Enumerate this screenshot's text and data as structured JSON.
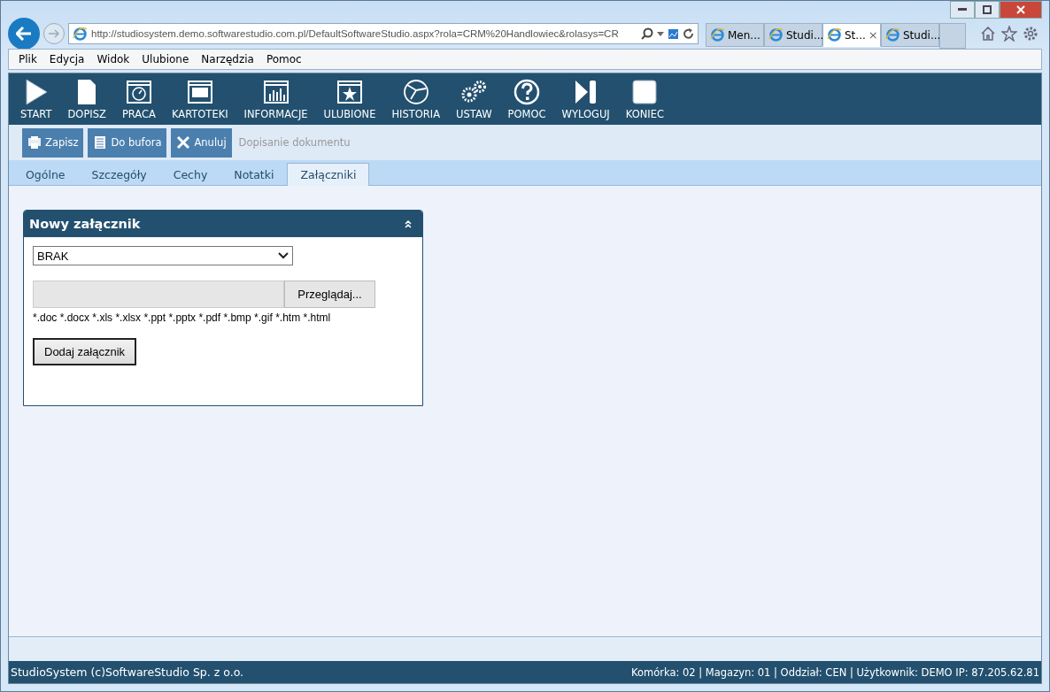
{
  "browser": {
    "address": "http://studiosystem.demo.softwarestudio.com.pl/DefaultSoftwareStudio.aspx?rola=CRM%20Handlowiec&rolasys=CR",
    "tabs": [
      {
        "label": "Men...",
        "selected": false
      },
      {
        "label": "Studi...",
        "selected": false
      },
      {
        "label": "St...",
        "selected": true
      },
      {
        "label": "Studi...",
        "selected": false
      }
    ],
    "close_tab": "×",
    "menu": [
      "Plik",
      "Edycja",
      "Widok",
      "Ulubione",
      "Narzędzia",
      "Pomoc"
    ]
  },
  "toolbar": [
    {
      "label": "START",
      "kind": "play"
    },
    {
      "label": "DOPISZ",
      "kind": "document"
    },
    {
      "label": "PRACA",
      "kind": "clock"
    },
    {
      "label": "KARTOTEKI",
      "kind": "window"
    },
    {
      "label": "INFORMACJE",
      "kind": "chart"
    },
    {
      "label": "ULUBIONE",
      "kind": "star"
    },
    {
      "label": "HISTORIA",
      "kind": "history"
    },
    {
      "label": "USTAW",
      "kind": "gears"
    },
    {
      "label": "POMOC",
      "kind": "help"
    },
    {
      "label": "WYLOGUJ",
      "kind": "logout"
    },
    {
      "label": "KONIEC",
      "kind": "stop"
    }
  ],
  "actions": [
    {
      "label": "Zapisz",
      "kind": "save"
    },
    {
      "label": "Do bufora",
      "kind": "list"
    },
    {
      "label": "Anuluj",
      "kind": "cancel"
    }
  ],
  "action_caption": "Dopisanie dokumentu",
  "tabs": [
    {
      "label": "Ogólne",
      "selected": false
    },
    {
      "label": "Szczegóły",
      "selected": false
    },
    {
      "label": "Cechy",
      "selected": false
    },
    {
      "label": "Notatki",
      "selected": false
    },
    {
      "label": "Załączniki",
      "selected": true
    }
  ],
  "panel": {
    "title": "Nowy załącznik",
    "type_select": "BRAK",
    "browse_button": "Przeglądaj...",
    "extensions": "*.doc *.docx *.xls *.xlsx *.ppt *.pptx *.pdf *.bmp *.gif *.htm *.html",
    "add_button": "Dodaj załącznik"
  },
  "status_bar": {
    "left": "StudioSystem (c)SoftwareStudio Sp. z o.o.",
    "right": "Komórka: 02 | Magazyn: 01 | Oddział: CEN | Użytkownik: DEMO IP: 87.205.62.81"
  }
}
